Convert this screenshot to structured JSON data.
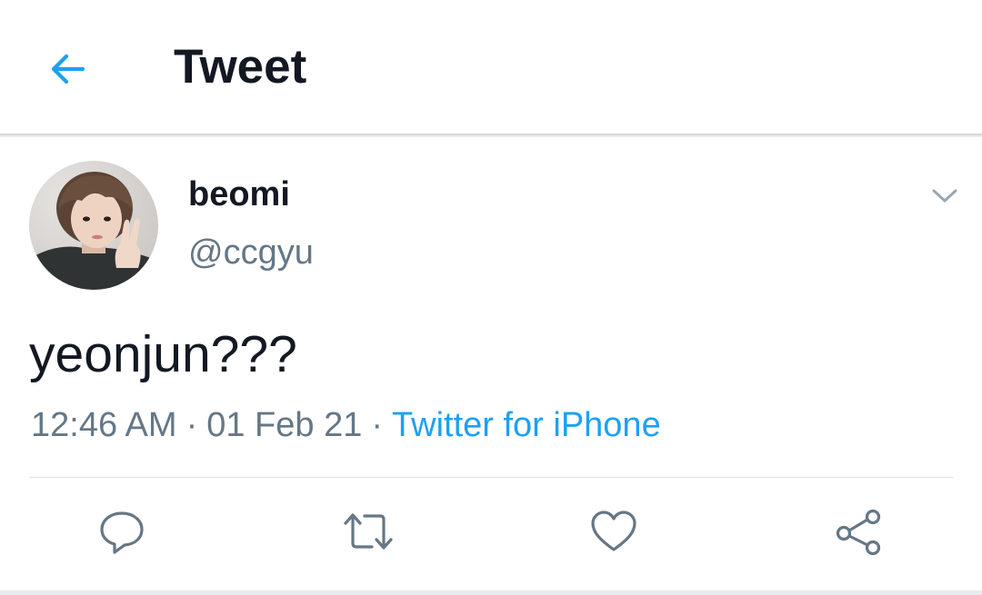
{
  "header": {
    "title": "Tweet",
    "back_icon": "arrow-left-icon",
    "accent_color": "#1da1f2"
  },
  "tweet": {
    "display_name": "beomi",
    "handle": "@ccgyu",
    "text": "yeonjun???",
    "time": "12:46 AM",
    "separator": "·",
    "date": "01 Feb 21",
    "source": "Twitter for iPhone",
    "menu_icon": "chevron-down-icon"
  },
  "actions": [
    {
      "name": "reply",
      "icon": "comment-icon"
    },
    {
      "name": "retweet",
      "icon": "retweet-icon"
    },
    {
      "name": "like",
      "icon": "heart-icon"
    },
    {
      "name": "share",
      "icon": "share-icon"
    }
  ],
  "colors": {
    "text_primary": "#141823",
    "text_secondary": "#657786",
    "link": "#1da1f2",
    "divider": "#d8e1e8"
  }
}
